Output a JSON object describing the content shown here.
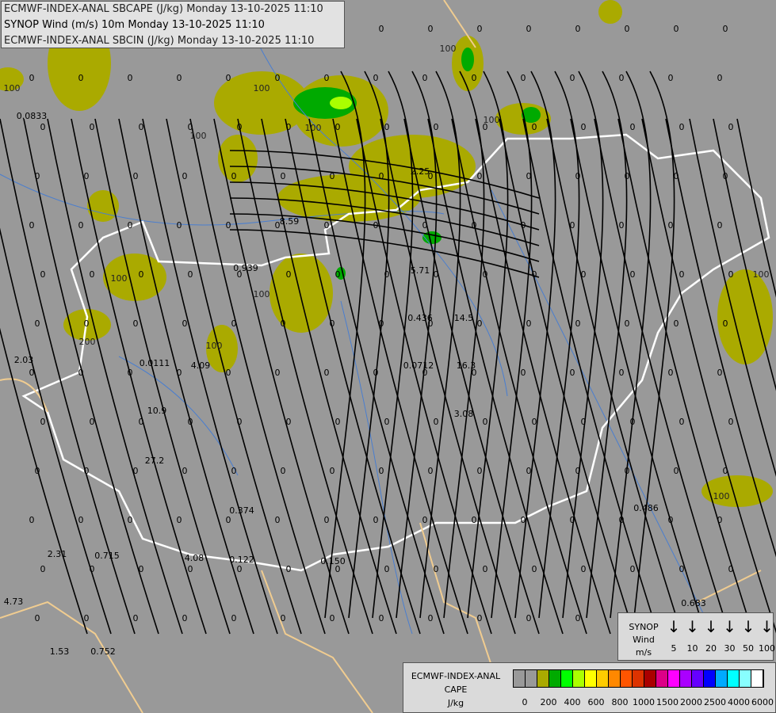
{
  "title": {
    "line1": "ECMWF-INDEX-ANAL SBCAPE (J/kg) Monday 13-10-2025 11:10",
    "line2": "SYNOP Wind (m/s) 10m Monday 13-10-2025 11:10",
    "line3": "ECMWF-INDEX-ANAL SBCIN (J/kg) Monday 13-10-2025 11:10"
  },
  "synop_legend": {
    "label1": "SYNOP",
    "label2": "Wind",
    "label3": "m/s",
    "speeds": [
      "5",
      "10",
      "20",
      "30",
      "50",
      "100"
    ],
    "arrow_icon": "down-arrow"
  },
  "cape_legend": {
    "label1": "ECMWF-INDEX-ANAL",
    "label2": "CAPE",
    "label3": "J/kg",
    "colors": [
      "#999999",
      "#999999",
      "#aaaa00",
      "#00aa00",
      "#00ff00",
      "#aaff00",
      "#ffff00",
      "#ffcc00",
      "#ff8800",
      "#ff5500",
      "#dd3300",
      "#aa0000",
      "#dd0088",
      "#ff00ff",
      "#aa00ff",
      "#6600ff",
      "#0000ff",
      "#00aaff",
      "#00ffff",
      "#88ffff",
      "#ffffff"
    ],
    "ticks": [
      "0",
      "200",
      "400",
      "600",
      "800",
      "1000",
      "1500",
      "2000",
      "2500",
      "4000",
      "6000"
    ]
  },
  "map": {
    "background": "#999999",
    "cape_contour_labels": [
      "100",
      "100",
      "100",
      "100",
      "200",
      "100",
      "100",
      "100",
      "100",
      "100",
      "100",
      "100"
    ],
    "cin_values": [
      "0.0833",
      "2.25",
      "8.59",
      "0.939",
      "5.71",
      "0.436",
      "14.5",
      "0.0712",
      "16.3",
      "2.03",
      "0.0111",
      "4.09",
      "10.9",
      "3.08",
      "27.2",
      "0.374",
      "0.486",
      "2.31",
      "0.715",
      "4.08",
      "0.122",
      "0.150",
      "4.73",
      "0.683",
      "1.53",
      "0.752"
    ]
  }
}
